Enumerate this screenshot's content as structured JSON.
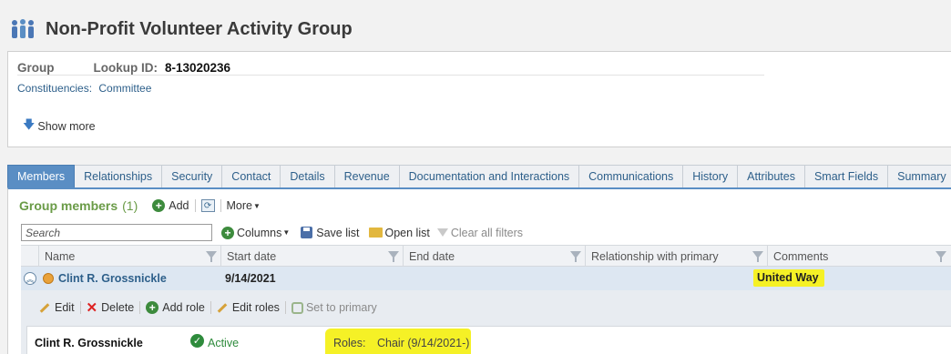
{
  "page": {
    "title": "Non-Profit Volunteer Activity Group",
    "icon": "people-group-icon"
  },
  "summary": {
    "group_label": "Group",
    "lookup_label": "Lookup ID:",
    "lookup_value": "8-13020236",
    "constituencies_label": "Constituencies:",
    "constituencies_value": "Committee",
    "show_more": "Show more"
  },
  "tabs": [
    {
      "label": "Members",
      "active": true
    },
    {
      "label": "Relationships"
    },
    {
      "label": "Security"
    },
    {
      "label": "Contact"
    },
    {
      "label": "Details"
    },
    {
      "label": "Revenue"
    },
    {
      "label": "Documentation and Interactions"
    },
    {
      "label": "Communications"
    },
    {
      "label": "History"
    },
    {
      "label": "Attributes"
    },
    {
      "label": "Smart Fields"
    },
    {
      "label": "Summary"
    }
  ],
  "members": {
    "title": "Group members",
    "count": "(1)",
    "add": "Add",
    "more": "More",
    "search_placeholder": "Search",
    "columns": "Columns",
    "save_list": "Save list",
    "open_list": "Open list",
    "clear_filters": "Clear all filters",
    "headers": [
      "Name",
      "Start date",
      "End date",
      "Relationship with primary",
      "Comments"
    ],
    "rows": [
      {
        "name": "Clint R. Grossnickle",
        "start_date": "9/14/2021",
        "end_date": "",
        "relationship": "",
        "comments": "United Way"
      }
    ],
    "actions": {
      "edit": "Edit",
      "delete": "Delete",
      "add_role": "Add role",
      "edit_roles": "Edit roles",
      "set_primary": "Set to primary"
    },
    "detail": {
      "name": "Clint R. Grossnickle",
      "status": "Active",
      "roles_label": "Roles:",
      "roles_value": "Chair (9/14/2021-)"
    }
  },
  "colors": {
    "accent": "#5a8ec4",
    "highlight": "#f5f126",
    "group_title": "#6a9b47",
    "link": "#2d5f8a"
  }
}
